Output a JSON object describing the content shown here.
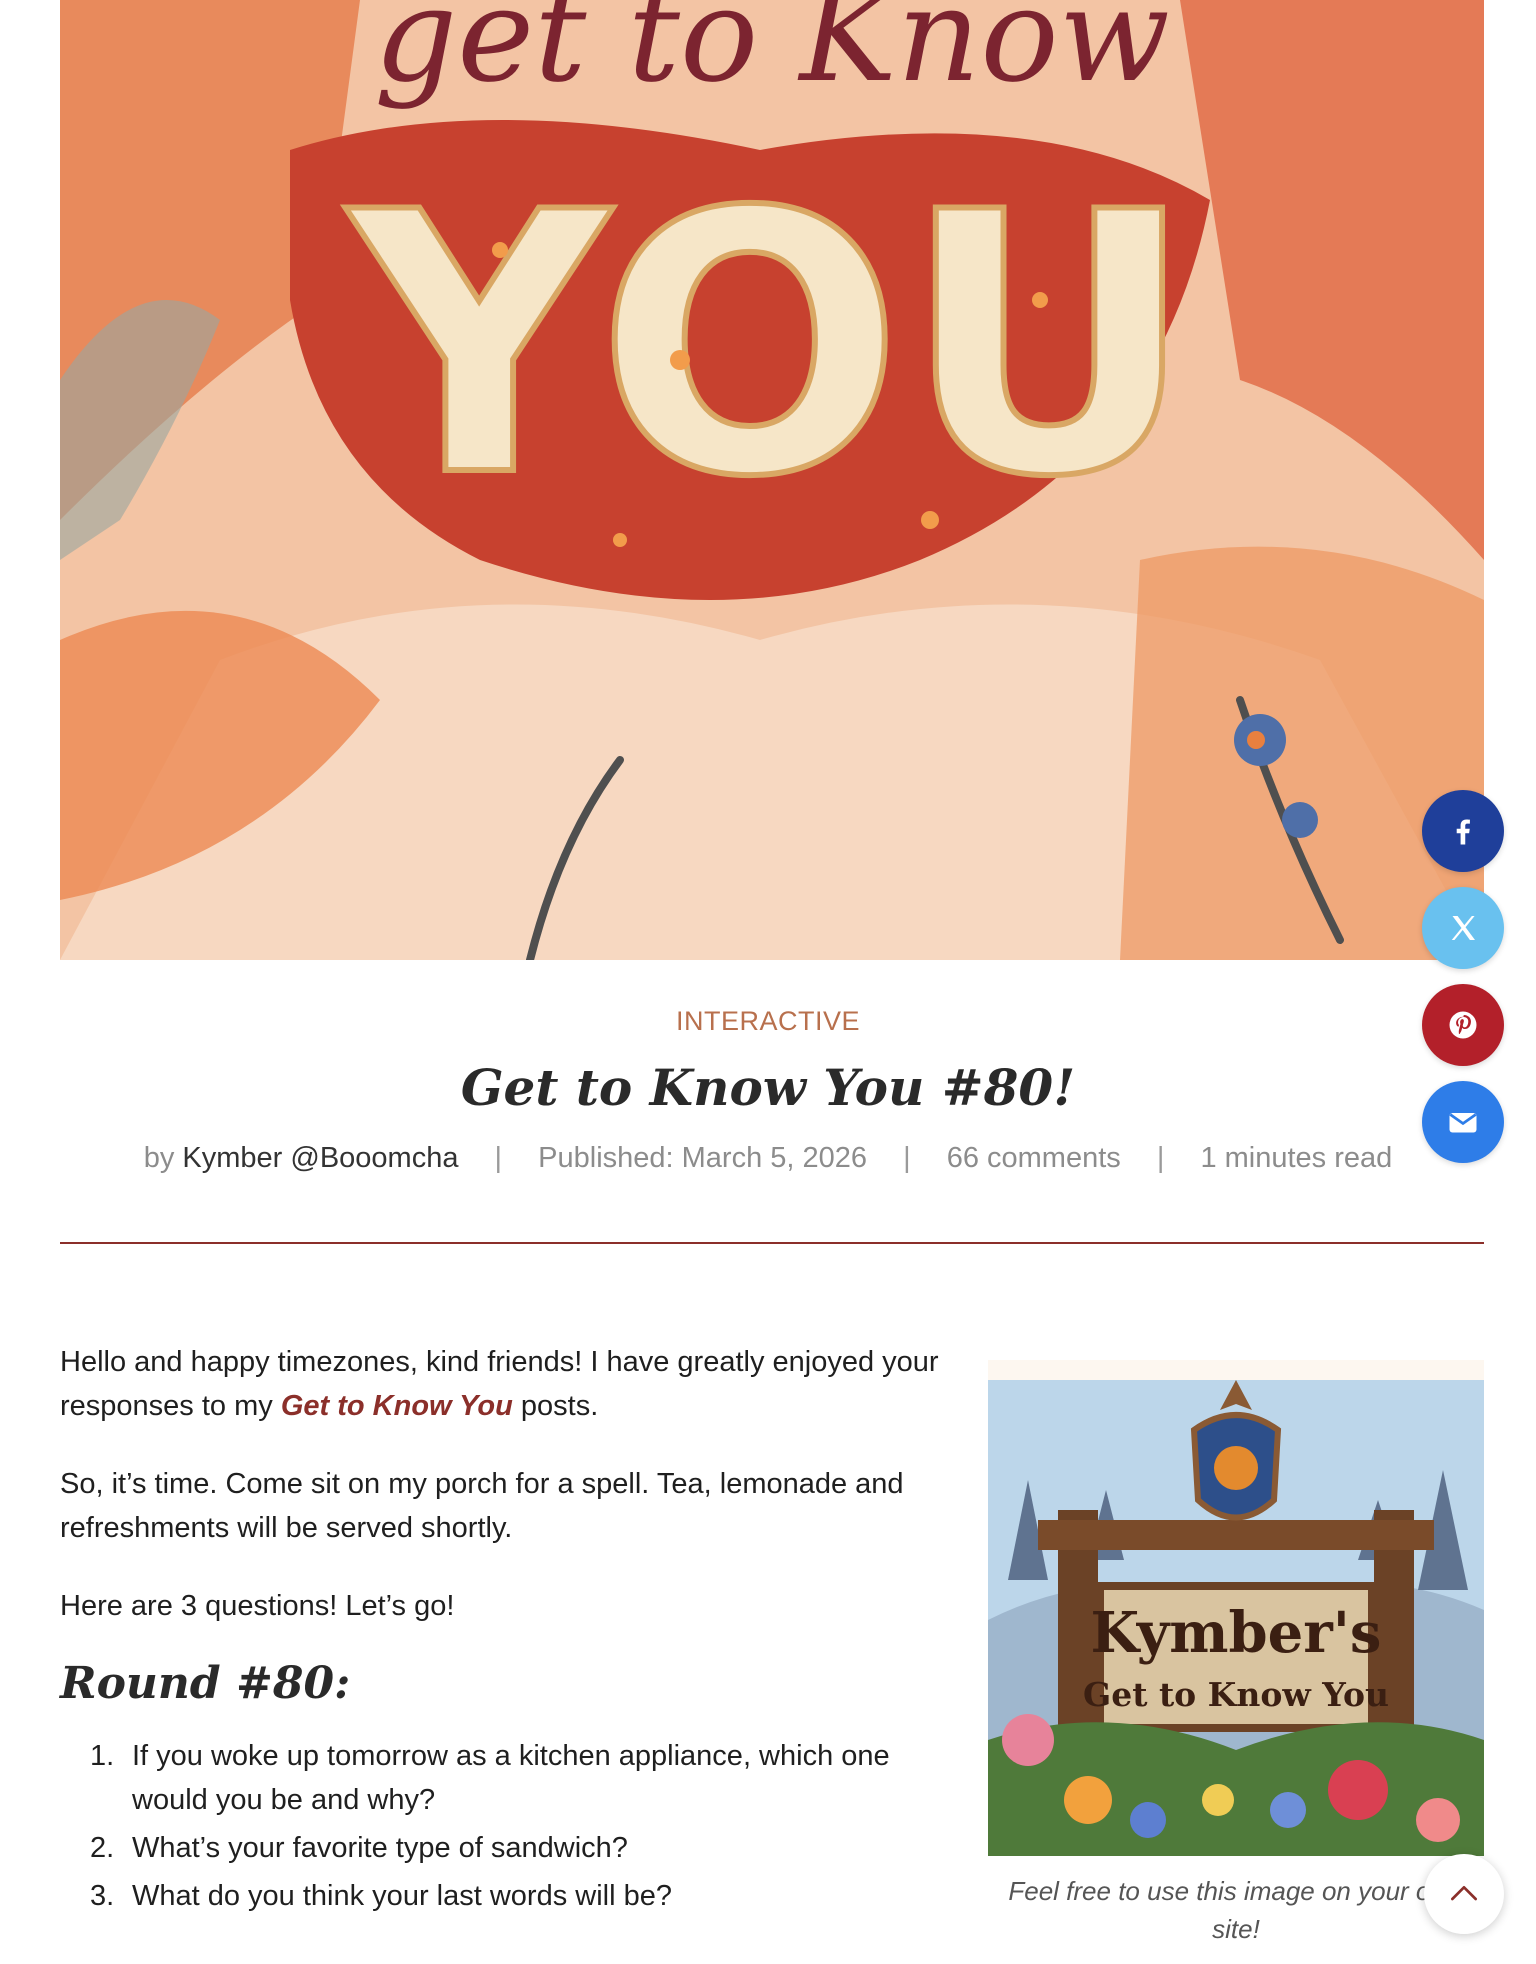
{
  "hero": {
    "headline_top": "get to Know",
    "headline_big": "YOU"
  },
  "share": {
    "facebook_icon": "facebook-icon",
    "x_icon": "x-twitter-icon",
    "pinterest_icon": "pinterest-icon",
    "email_icon": "envelope-icon"
  },
  "post": {
    "category": "INTERACTIVE",
    "title": "Get to Know You #80!",
    "by_prefix": "by",
    "author": "Kymber @Booomcha",
    "separator": "|",
    "published": "Published: March 5, 2026",
    "comments": "66 comments",
    "read_time": "1 minutes read"
  },
  "body": {
    "p1_before": "Hello and happy timezones, kind friends! I have greatly enjoyed your responses to my ",
    "p1_link": "Get to Know You",
    "p1_after": " posts.",
    "p2": "So, it’s time. Come sit on my porch for a spell. Tea, lemonade and refreshments will be served shortly.",
    "p3": "Here are 3 questions! Let’s go!",
    "round_heading": "Round #80:",
    "questions": [
      {
        "num": "1.",
        "text": "If you woke up tomorrow as a kitchen appliance, which one would you be and why?"
      },
      {
        "num": "2.",
        "text": "What’s your favorite type of sandwich?"
      },
      {
        "num": "3.",
        "text": "What do you think your last words will be?"
      }
    ]
  },
  "side_image": {
    "sign_line1": "Kymber's",
    "sign_line2": "Get to Know You",
    "caption": "Feel free to use this image on your own site!"
  },
  "colors": {
    "accent": "#8b2f2a",
    "category": "#b8704d",
    "facebook": "#1f3f9a",
    "x": "#69c1ef",
    "pinterest": "#b3202a",
    "email": "#2e7de8"
  }
}
